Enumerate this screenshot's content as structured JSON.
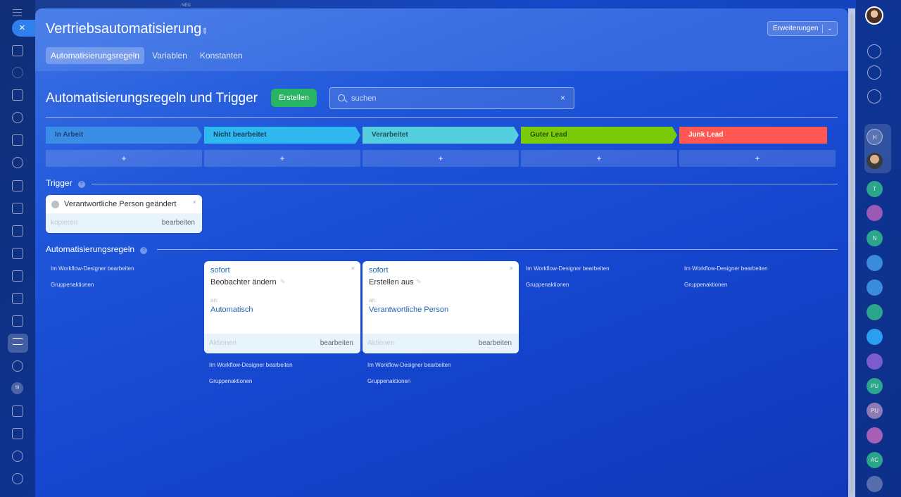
{
  "header": {
    "title": "Vertriebsautomatisierung",
    "extensions_label": "Erweiterungen",
    "new_badge": "NEU"
  },
  "tabs": [
    {
      "label": "Automatisierungsregeln"
    },
    {
      "label": "Variablen"
    },
    {
      "label": "Konstanten"
    }
  ],
  "section": {
    "title": "Automatisierungsregeln und Trigger",
    "create_label": "Erstellen"
  },
  "search": {
    "placeholder": "suchen",
    "value": ""
  },
  "stages": [
    {
      "label": "In Arbeit",
      "color": "#3b8ee6",
      "text_color": "#1e3f7a",
      "add": "+"
    },
    {
      "label": "Nicht bearbeitet",
      "color": "#2fb7f0",
      "text_color": "#17405e",
      "add": "+"
    },
    {
      "label": "Verarbeitet",
      "color": "#55cfe0",
      "text_color": "#1d5560",
      "add": "+"
    },
    {
      "label": "Guter Lead",
      "color": "#7acc0a",
      "text_color": "#2e4d05",
      "add": "+"
    },
    {
      "label": "Junk Lead",
      "color": "#ff5752",
      "text_color": "#ffffff",
      "add": "+"
    }
  ],
  "triggers": {
    "title": "Trigger",
    "help": "?",
    "card": {
      "label": "Verantwortliche Person geändert",
      "copy": "kopieren",
      "edit": "bearbeiten"
    }
  },
  "rules": {
    "title": "Automatisierungsregeln",
    "help": "?",
    "designer_link": "Im Workflow-Designer bearbeiten",
    "group_actions": "Gruppenaktionen",
    "cards": [
      {
        "timing": "sofort",
        "action": "Beobachter ändern",
        "to_label": "an:",
        "target": "Automatisch",
        "actions": "Aktionen",
        "edit": "bearbeiten"
      },
      {
        "timing": "sofort",
        "action": "Erstellen aus",
        "to_label": "an:",
        "target": "Verantwortliche Person",
        "actions": "Aktionen",
        "edit": "bearbeiten"
      }
    ]
  },
  "sidebar": {
    "close": "×",
    "si_avatar": "SI"
  },
  "right_sidebar": {
    "avatars": [
      "H",
      "T",
      "N",
      "PU",
      "PU",
      "AC"
    ]
  }
}
